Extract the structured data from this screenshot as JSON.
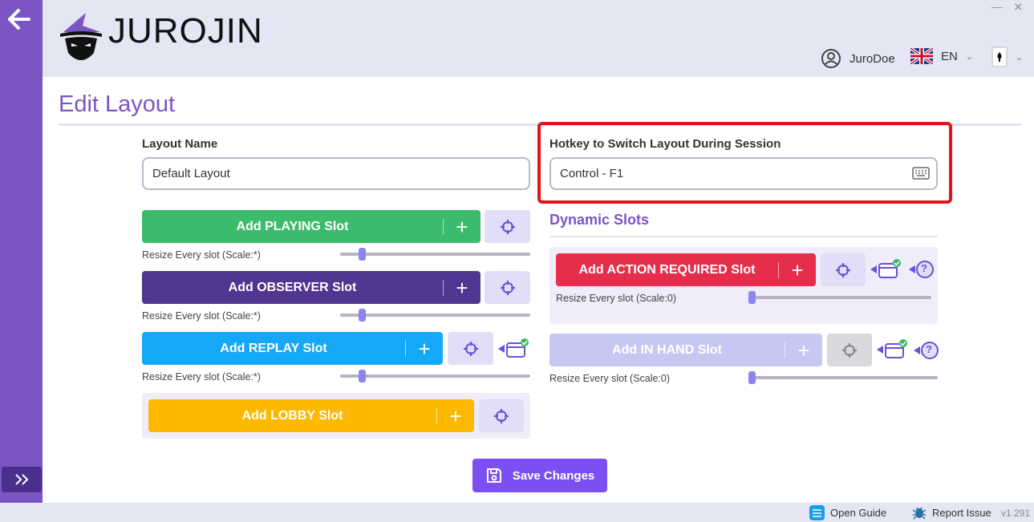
{
  "app": {
    "logo_text": "JUROJIN",
    "win_minimize": "—",
    "win_close": "✕"
  },
  "header": {
    "username": "JuroDoe",
    "language": "EN"
  },
  "page": {
    "title": "Edit Layout"
  },
  "form": {
    "layout_name_label": "Layout Name",
    "layout_name_value": "Default Layout",
    "hotkey_label": "Hotkey to Switch Layout During Session",
    "hotkey_value": "Control - F1"
  },
  "slots": [
    {
      "label": "Add PLAYING Slot",
      "plus": "+",
      "resize": "Resize Every slot (Scale:*)",
      "color": "#3dbb6c",
      "scale": 0.1
    },
    {
      "label": "Add OBSERVER Slot",
      "plus": "+",
      "resize": "Resize Every slot (Scale:*)",
      "color": "#513590",
      "scale": 0.1
    },
    {
      "label": "Add REPLAY Slot",
      "plus": "+",
      "resize": "Resize Every slot (Scale:*)",
      "color": "#15a8f7",
      "scale": 0.1
    },
    {
      "label": "Add LOBBY Slot",
      "plus": "+",
      "color": "#fcb900"
    }
  ],
  "dynamic": {
    "title": "Dynamic Slots",
    "action_required": {
      "label": "Add ACTION REQUIRED Slot",
      "plus": "+",
      "resize": "Resize Every slot (Scale:0)",
      "color": "#e62e4c",
      "scale": 0
    },
    "in_hand": {
      "label": "Add IN HAND Slot",
      "plus": "+",
      "resize": "Resize Every slot (Scale:0)",
      "color": "#c7c7f3",
      "scale": 0
    },
    "help_glyph": "?"
  },
  "save": {
    "label": "Save Changes"
  },
  "footer": {
    "open_guide": "Open Guide",
    "report_issue": "Report Issue",
    "version": "v1.291"
  },
  "colors": {
    "accent": "#7c55c4",
    "highlight": "#e0141a",
    "save": "#7b4ff2"
  },
  "icons": [
    "back-arrow-icon",
    "expand-icon",
    "wizard-logo-icon",
    "user-icon",
    "uk-flag-icon",
    "card-icon",
    "keyboard-icon",
    "crosshair-icon",
    "window-check-icon",
    "help-icon",
    "save-icon",
    "guide-icon",
    "bug-icon"
  ]
}
